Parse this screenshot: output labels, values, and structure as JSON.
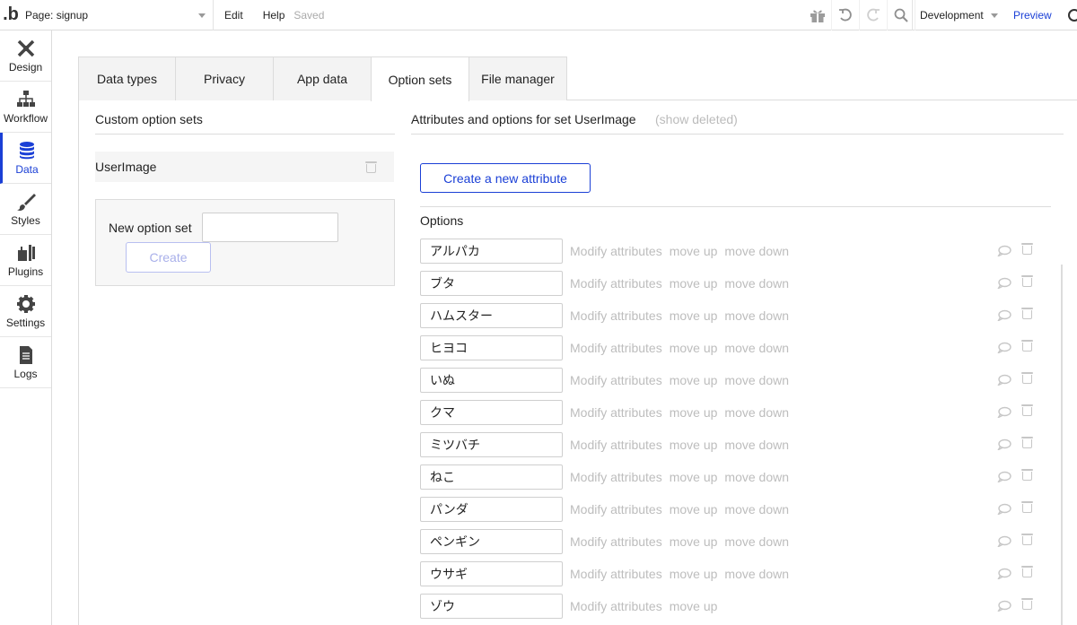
{
  "topbar": {
    "logo": ".b",
    "page_select": "Page: signup",
    "menu": [
      "Edit",
      "Help"
    ],
    "saved": "Saved",
    "environment": "Development",
    "preview": "Preview"
  },
  "sidebar": {
    "items": [
      {
        "label": "Design",
        "icon": "design-icon"
      },
      {
        "label": "Workflow",
        "icon": "workflow-icon"
      },
      {
        "label": "Data",
        "icon": "database-icon",
        "active": true
      },
      {
        "label": "Styles",
        "icon": "brush-icon"
      },
      {
        "label": "Plugins",
        "icon": "plug-icon"
      },
      {
        "label": "Settings",
        "icon": "gear-icon"
      },
      {
        "label": "Logs",
        "icon": "document-icon"
      }
    ]
  },
  "tabs": [
    "Data types",
    "Privacy",
    "App data",
    "Option sets",
    "File manager"
  ],
  "active_tab": "Option sets",
  "left_panel": {
    "title": "Custom option sets",
    "sets": [
      "UserImage"
    ],
    "new_set_label": "New option set",
    "new_set_value": "",
    "create_label": "Create"
  },
  "right_panel": {
    "title": "Attributes and options for set UserImage",
    "show_deleted": "(show deleted)",
    "new_attribute_label": "Create a new attribute",
    "options_label": "Options",
    "action_labels": {
      "modify": "Modify attributes",
      "up": "move up",
      "down": "move down"
    },
    "options": [
      "アルパカ",
      "ブタ",
      "ハムスター",
      "ヒヨコ",
      "いぬ",
      "クマ",
      "ミツバチ",
      "ねこ",
      "パンダ",
      "ペンギン",
      "ウサギ",
      "ゾウ"
    ]
  },
  "colors": {
    "accent": "#1a3fd6",
    "muted_text": "#bdbdbd",
    "border": "#dcdcdc"
  }
}
